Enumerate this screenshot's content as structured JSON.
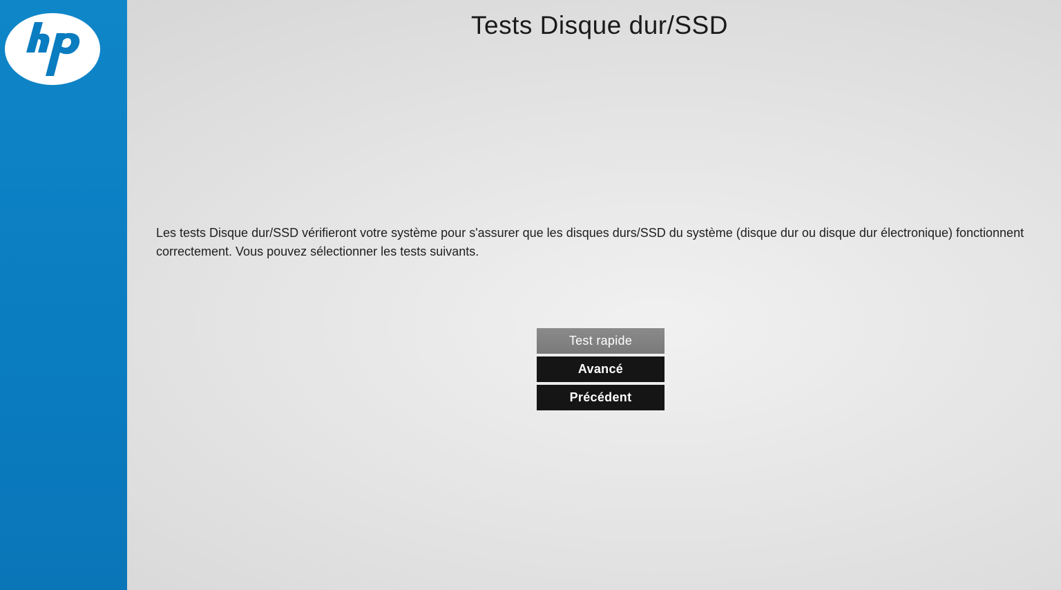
{
  "window": {
    "title": "Tests Disque dur/SSD"
  },
  "branding": {
    "logo_icon": "hp-logo-icon",
    "sidebar_color": "#0a7cc0"
  },
  "main": {
    "description": "Les tests Disque dur/SSD vérifieront votre système pour s'assurer que les disques durs/SSD du système (disque dur ou disque dur électronique) fonctionnent correctement. Vous pouvez sélectionner les tests suivants."
  },
  "menu": {
    "buttons": [
      {
        "label": "Test rapide",
        "selected": true
      },
      {
        "label": "Avancé",
        "selected": false
      },
      {
        "label": "Précédent",
        "selected": false
      }
    ],
    "selected_color": "#808080",
    "default_color": "#151515"
  }
}
